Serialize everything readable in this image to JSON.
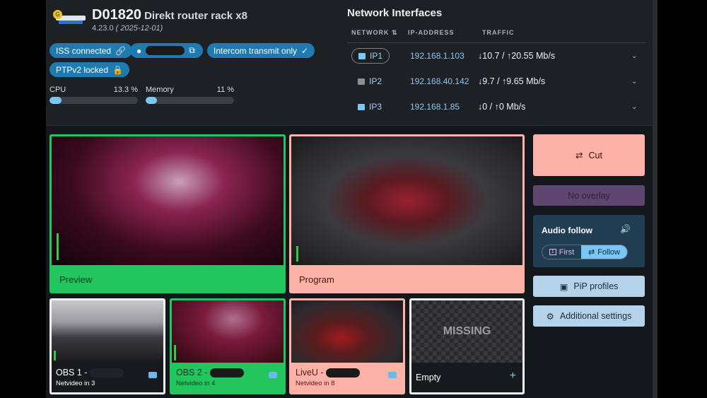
{
  "device": {
    "id": "D01820",
    "name": "Direkt router rack x8",
    "version": "4.23.0",
    "date": "( 2025-12-01)"
  },
  "chips": {
    "iss": "ISS connected",
    "intercom": "Intercom transmit only",
    "ptp": "PTPv2 locked"
  },
  "stats": {
    "cpu_label": "CPU",
    "cpu_value": "13.3 %",
    "cpu_pct": 13.3,
    "mem_label": "Memory",
    "mem_value": "11 %",
    "mem_pct": 11
  },
  "network": {
    "title": "Network Interfaces",
    "headers": {
      "network": "NETWORK",
      "ip": "IP-ADDRESS",
      "traffic": "TRAFFIC"
    },
    "rows": [
      {
        "name": "IP1",
        "ip": "192.168.1.103",
        "traffic": "↓10.7 / ↑20.55 Mb/s"
      },
      {
        "name": "IP2",
        "ip": "192.168.40.142",
        "traffic": "↓9.7 / ↑9.65 Mb/s"
      },
      {
        "name": "IP3",
        "ip": "192.168.1.85",
        "traffic": "↓0 / ↑0 Mb/s"
      }
    ]
  },
  "preview": {
    "label": "Preview"
  },
  "program": {
    "label": "Program"
  },
  "controls": {
    "cut": "Cut",
    "overlay": "No overlay",
    "audio_title": "Audio follow",
    "first": "First",
    "follow": "Follow",
    "pip": "PiP profiles",
    "settings": "Additional settings"
  },
  "sources": [
    {
      "name": "OBS 1 -",
      "sub": "Netvideo in 3"
    },
    {
      "name": "OBS 2 -",
      "sub": "Netvideo in 4"
    },
    {
      "name": "LiveU -",
      "sub": "Netvideo in 8"
    },
    {
      "name": "Empty",
      "missing": "MISSING"
    }
  ],
  "colors": {
    "preview": "#22c55e",
    "program": "#fdb2a8",
    "chip": "#1e7bb0",
    "overlay": "#5e4670"
  }
}
